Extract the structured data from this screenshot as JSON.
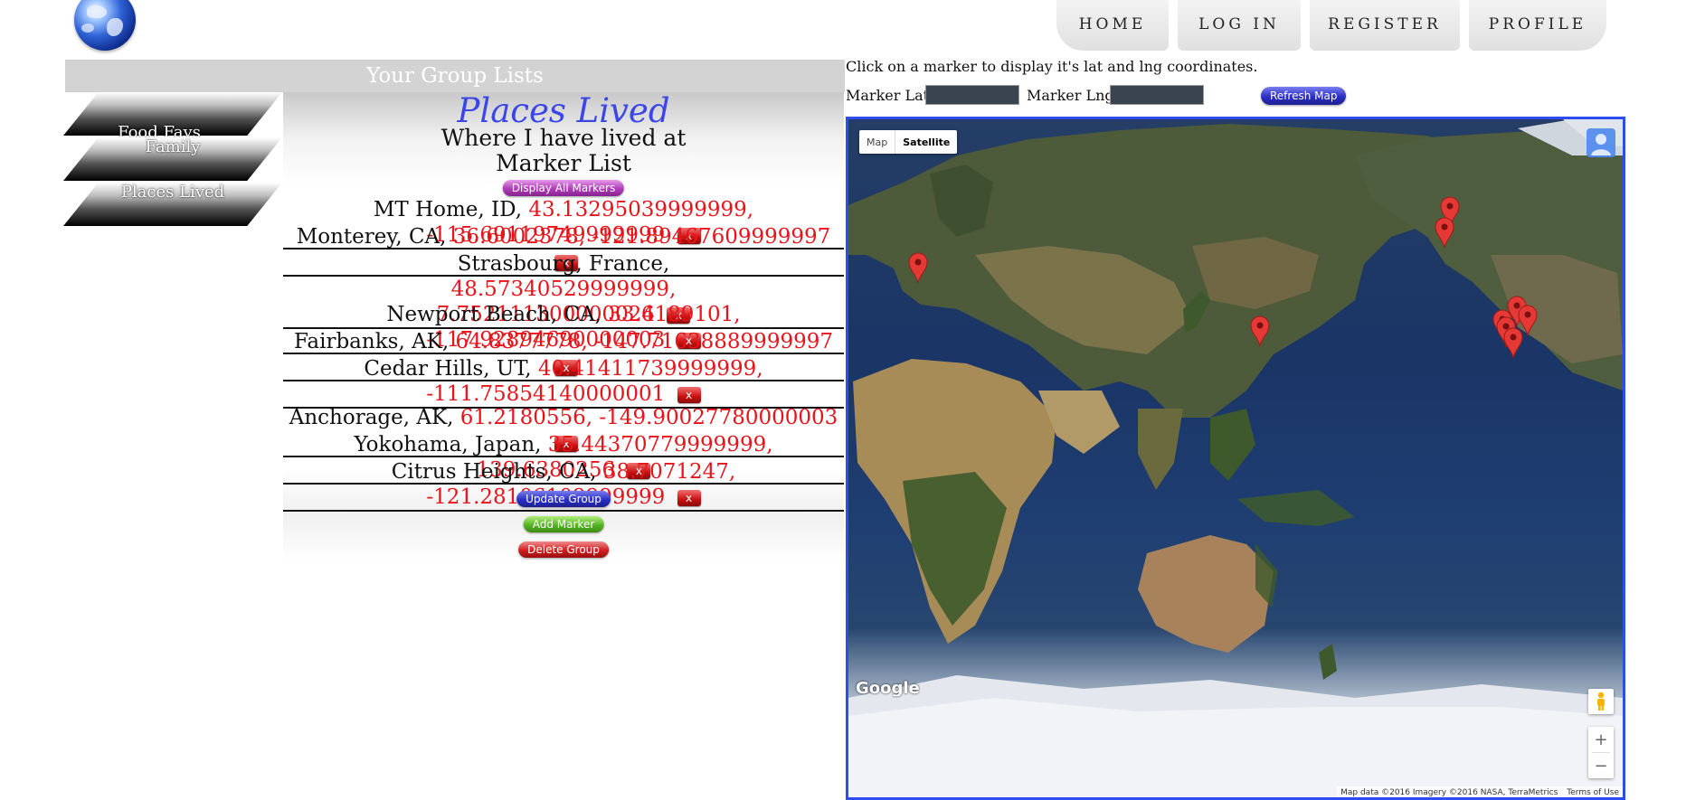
{
  "nav": [
    "HOME",
    "LOG IN",
    "REGISTER",
    "PROFILE"
  ],
  "group_lists": {
    "header": "Your Group Lists",
    "groups": [
      "Food Favs",
      "Family",
      "Places Lived"
    ]
  },
  "panel": {
    "title": "Places Lived",
    "subtitle": "Where I have lived at",
    "list_heading": "Marker List",
    "display_all": "Display All Markers",
    "delete_label": "x",
    "markers": [
      {
        "name": "MT Home, ID",
        "coords": "43.13295039999999, -115.69119749999999"
      },
      {
        "name": "Monterey, CA",
        "coords": "36.6002378, -121.89467609999997"
      },
      {
        "name": "Strasbourg, France",
        "coords": "48.57340529999999, 7.752111300000024"
      },
      {
        "name": "Newport Beach, CA",
        "coords": "33.6189101, -117.92894690000003"
      },
      {
        "name": "Fairbanks, AK",
        "coords": "64.8377778, -147.71638889999997"
      },
      {
        "name": "Cedar Hills, UT",
        "coords": "40.41411739999999, -111.75854140000001"
      },
      {
        "name": "Anchorage, AK",
        "coords": "61.2180556, -149.90027780000003"
      },
      {
        "name": "Yokohama, Japan",
        "coords": "35.44370779999999, 139.6380256"
      },
      {
        "name": "Citrus Heights, CA",
        "coords": "38.7071247, -121.28106109999999"
      }
    ],
    "update_group": "Update Group",
    "add_marker": "Add Marker",
    "delete_group": "Delete Group"
  },
  "map_panel": {
    "instructions": "Click on a marker to display it's lat and lng coordinates.",
    "lat_label": "Marker Lat:",
    "lng_label": "Marker Lng:",
    "lat_value": "",
    "lng_value": "",
    "refresh": "Refresh Map",
    "type_map": "Map",
    "type_satellite": "Satellite",
    "selected_type": "Satellite",
    "google": "Google",
    "attribution": "Map data ©2016 Imagery ©2016 NASA, TerraMetrics",
    "terms": "Terms of Use"
  },
  "colors": {
    "accent_blue": "#3a46e8",
    "coords_red": "#e8141a",
    "map_border": "#2f4cf0",
    "marker_pin": "#e53935"
  }
}
